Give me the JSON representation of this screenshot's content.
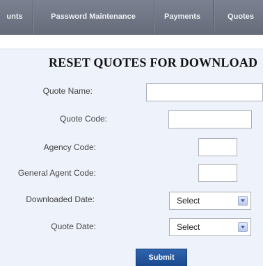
{
  "nav": {
    "items": [
      {
        "label": "unts"
      },
      {
        "label": "Password Maintenance"
      },
      {
        "label": "Payments"
      },
      {
        "label": "Quotes"
      }
    ]
  },
  "form": {
    "title": "RESET QUOTES FOR DOWNLOAD",
    "fields": {
      "quote_name": {
        "label": "Quote Name:",
        "value": ""
      },
      "quote_code": {
        "label": "Quote Code:",
        "value": ""
      },
      "agency_code": {
        "label": "Agency Code:",
        "value": ""
      },
      "general_agent_code": {
        "label": "General Agent Code:",
        "value": ""
      },
      "downloaded_date": {
        "label": "Downloaded Date:",
        "selected": "Select"
      },
      "quote_date": {
        "label": "Quote Date:",
        "selected": "Select"
      }
    },
    "submit_label": "Submit"
  }
}
